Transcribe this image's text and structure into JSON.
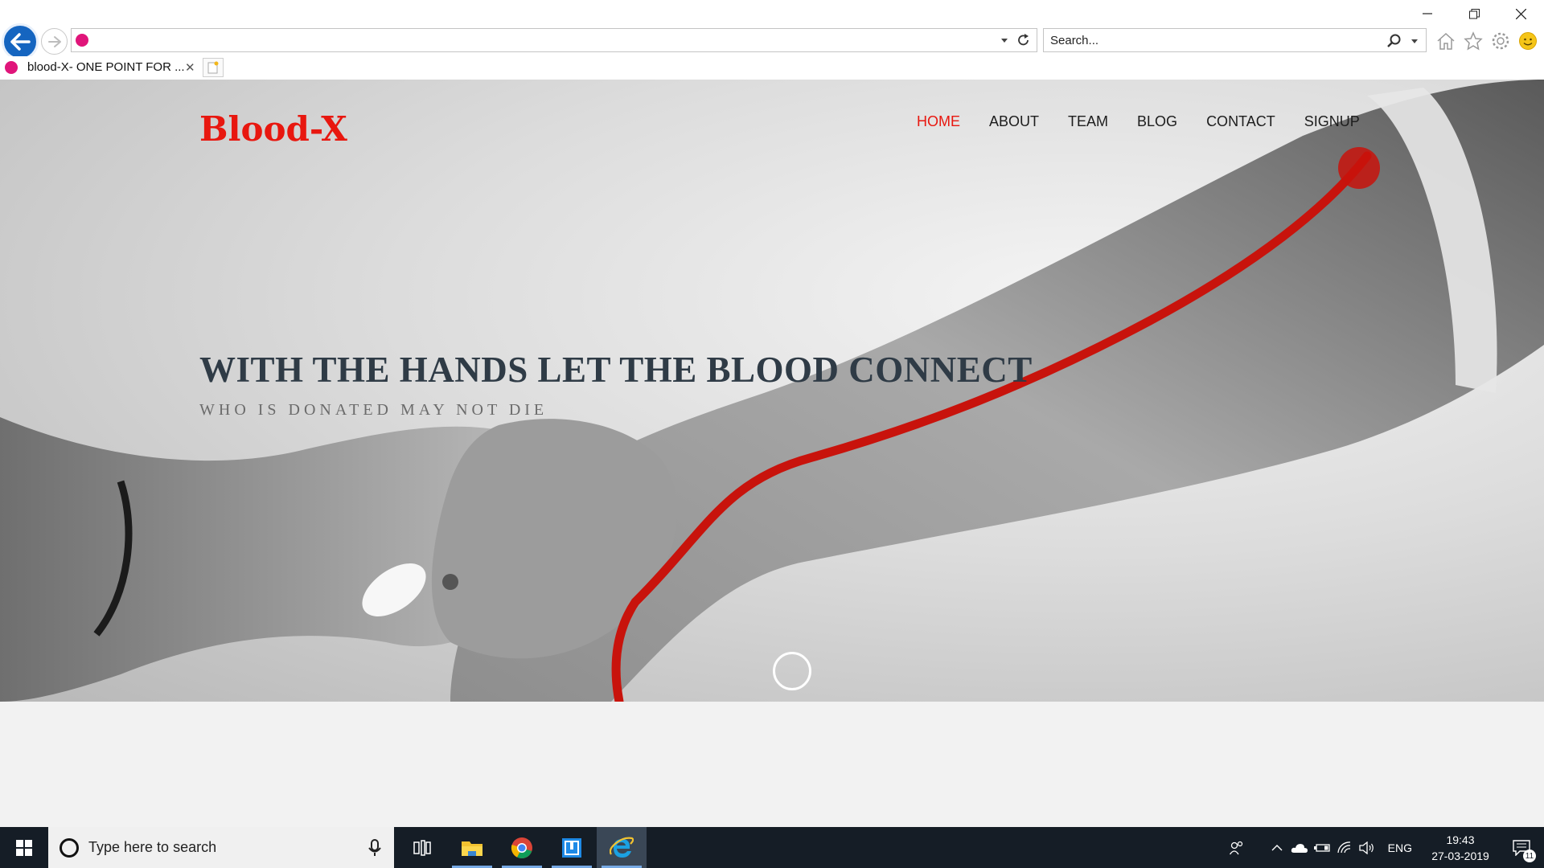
{
  "browser": {
    "tab_title": "blood-X- ONE POINT FOR ...",
    "search_placeholder": "Search...",
    "address_value": ""
  },
  "site": {
    "logo": "Blood-X",
    "nav": [
      {
        "label": "HOME",
        "active": true
      },
      {
        "label": "ABOUT",
        "active": false
      },
      {
        "label": "TEAM",
        "active": false
      },
      {
        "label": "BLOG",
        "active": false
      },
      {
        "label": "CONTACT",
        "active": false
      },
      {
        "label": "SIGNUP",
        "active": false
      }
    ],
    "hero_title": "WITH THE HANDS LET THE BLOOD CONNECT",
    "hero_subtitle": "WHO IS DONATED MAY NOT DIE",
    "colors": {
      "accent": "#e8170f",
      "title": "#2f3b46"
    }
  },
  "taskbar": {
    "search_placeholder": "Type here to search",
    "language": "ENG",
    "time": "19:43",
    "date": "27-03-2019",
    "notification_count": "11",
    "apps": [
      "task-view-icon",
      "file-explorer-icon",
      "chrome-icon",
      "store-app-icon",
      "internet-explorer-icon"
    ]
  }
}
